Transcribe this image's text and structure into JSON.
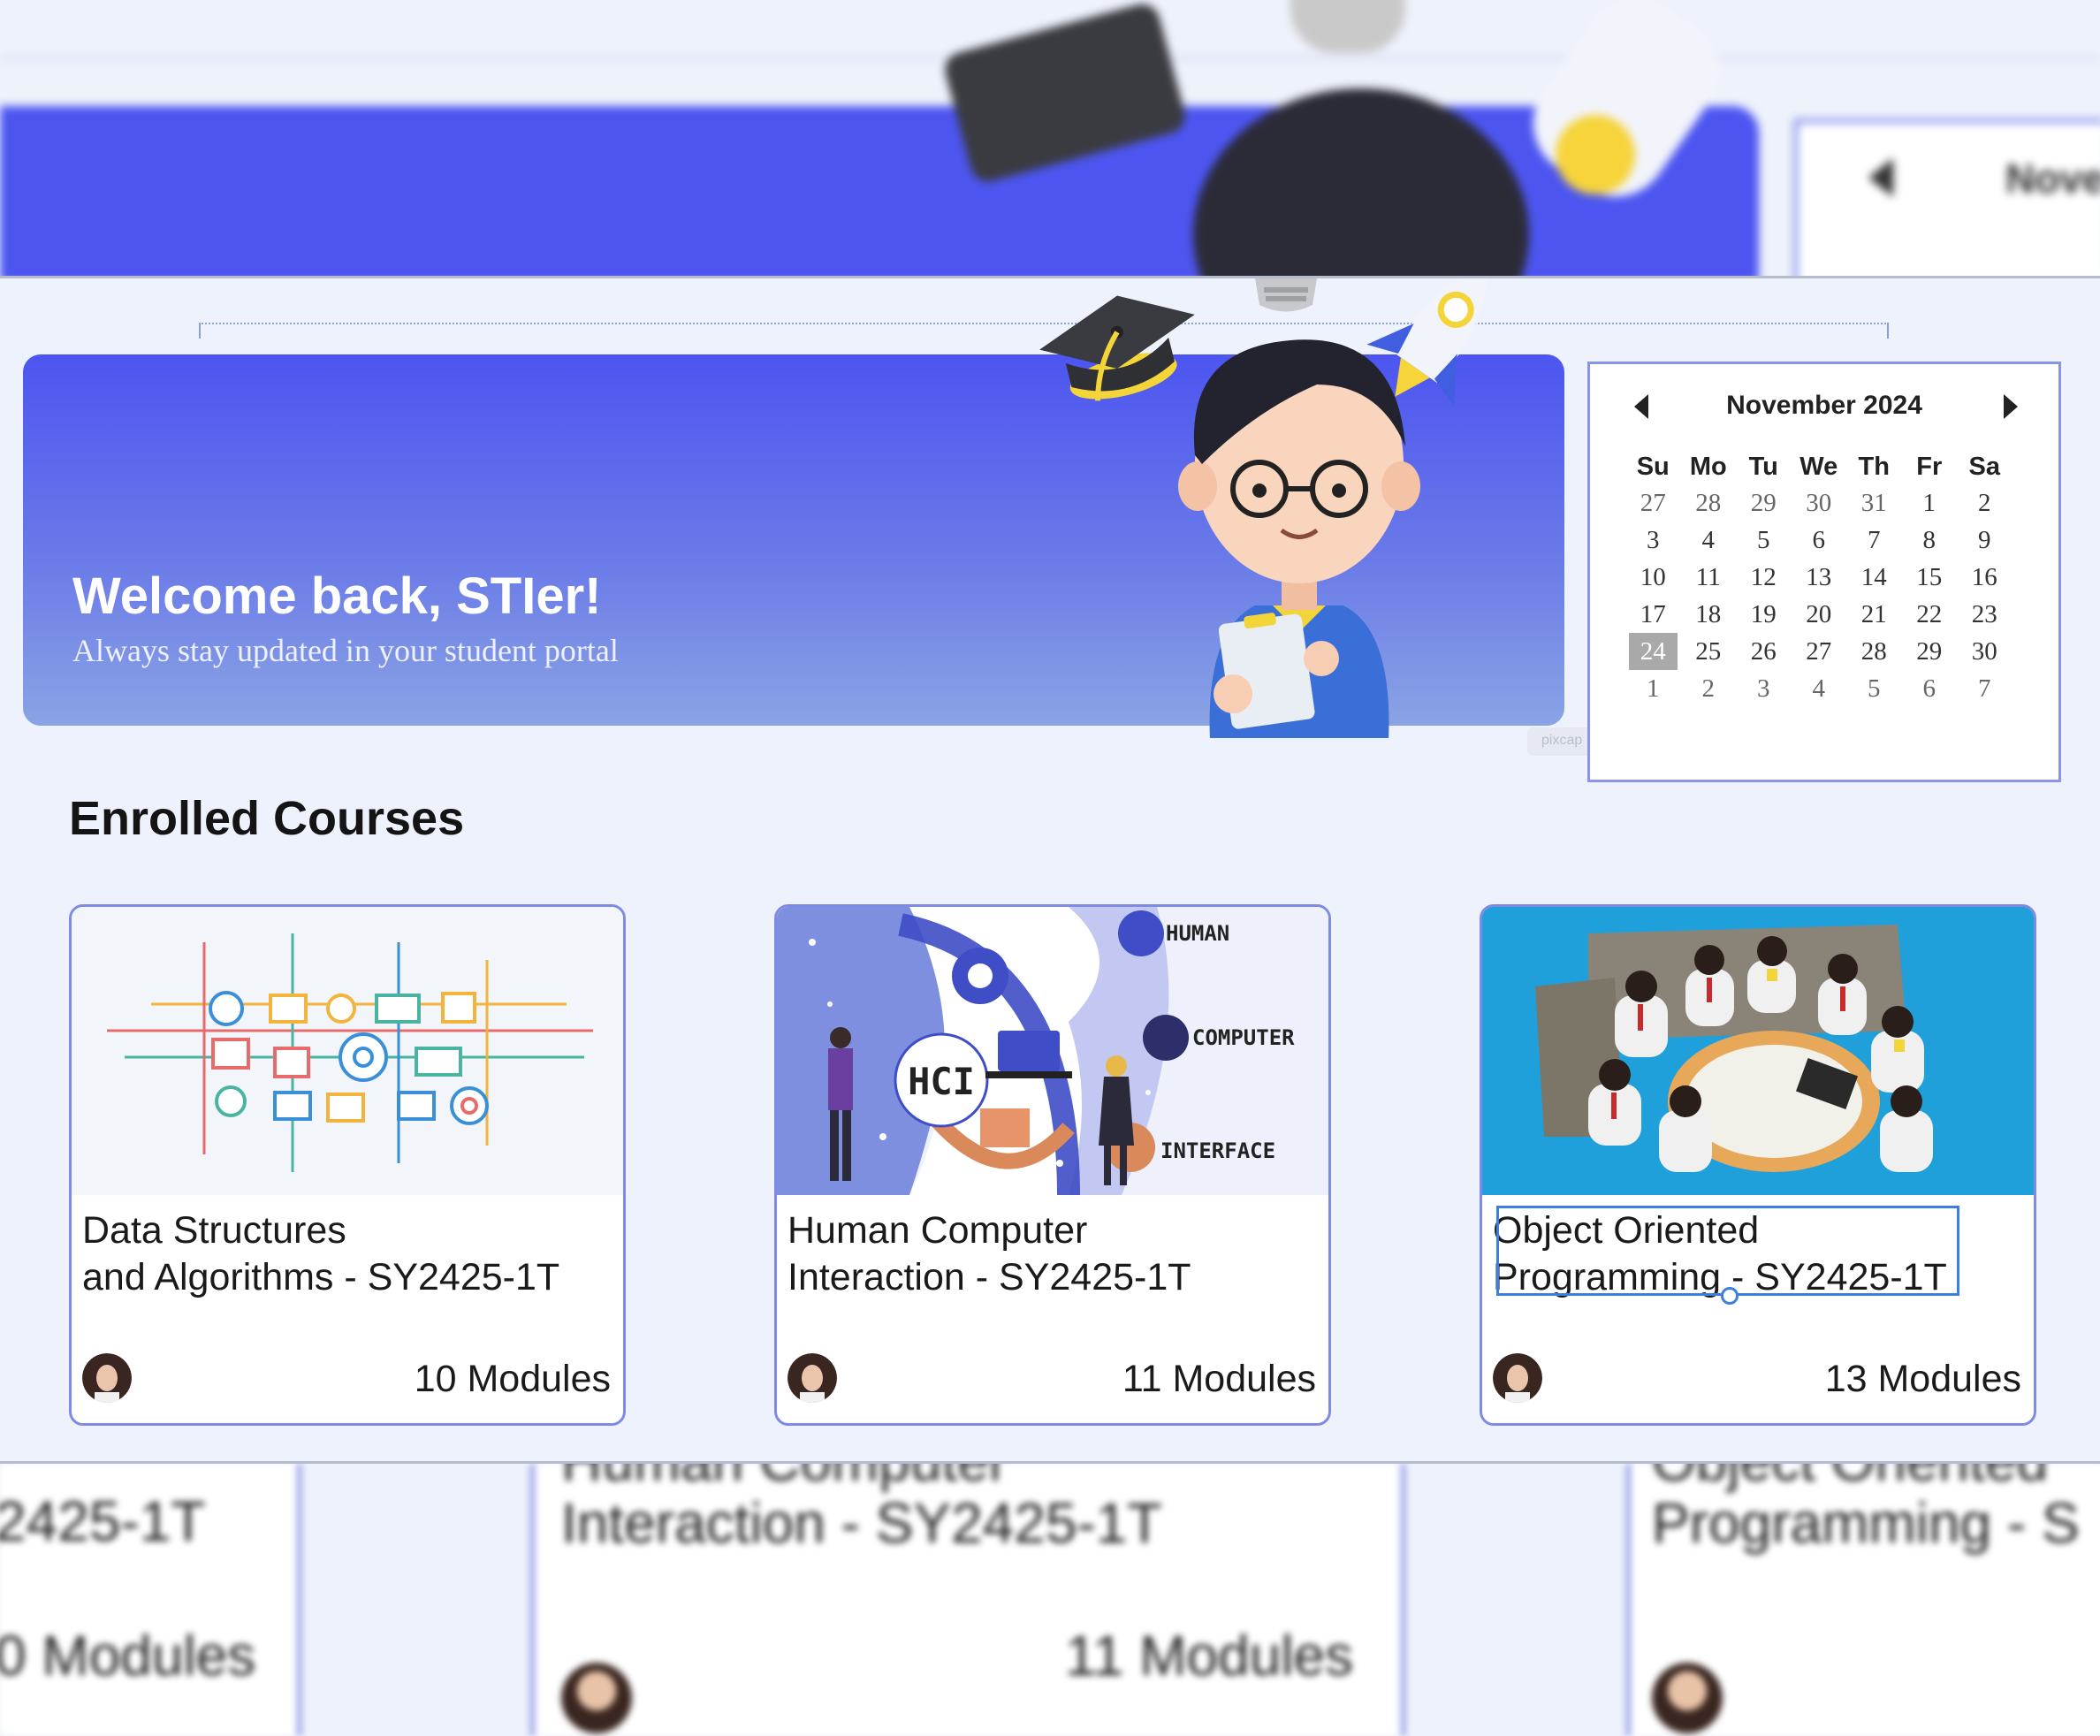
{
  "banner": {
    "welcome": "Welcome back,  STIer!",
    "subtitle": "Always stay updated in your student portal",
    "watermark": "pixcap"
  },
  "calendar": {
    "month_label": "November 2024",
    "weekdays": [
      "Su",
      "Mo",
      "Tu",
      "We",
      "Th",
      "Fr",
      "Sa"
    ],
    "weeks": [
      [
        "27",
        "28",
        "29",
        "30",
        "31",
        "1",
        "2"
      ],
      [
        "3",
        "4",
        "5",
        "6",
        "7",
        "8",
        "9"
      ],
      [
        "10",
        "11",
        "12",
        "13",
        "14",
        "15",
        "16"
      ],
      [
        "17",
        "18",
        "19",
        "20",
        "21",
        "22",
        "23"
      ],
      [
        "24",
        "25",
        "26",
        "27",
        "28",
        "29",
        "30"
      ],
      [
        "1",
        "2",
        "3",
        "4",
        "5",
        "6",
        "7"
      ]
    ],
    "selected_day": "24"
  },
  "courses_section": {
    "title": "Enrolled Courses",
    "courses": [
      {
        "title_line1": "Data Structures",
        "title_line2": "and Algorithms - SY2425-1T",
        "modules": "10 Modules"
      },
      {
        "title_line1": "Human Computer",
        "title_line2": "Interaction - SY2425-1T",
        "modules": "11 Modules",
        "thumb_labels": {
          "center": "HCI",
          "human": "HUMAN",
          "computer": "COMPUTER",
          "interface": "INTERFACE"
        }
      },
      {
        "title_line1": "Object Oriented",
        "title_line2": "Programming - SY2425-1T",
        "modules": "13 Modules"
      }
    ]
  },
  "background": {
    "cal_title": "Nove",
    "course2_line1": "Human Computer",
    "course2_line2": "Interaction - SY2425-1T",
    "course1_tail": "2425-1T",
    "course1_modules": "0 Modules",
    "course2_modules": "11 Modules",
    "course3_line1": "Object Oriented",
    "course3_line2": "Programming - S"
  },
  "colors": {
    "banner": "#4c55f0",
    "card_border": "#7f8ae6",
    "selection": "#3d7fe0",
    "page_bg": "#eef2fd"
  }
}
